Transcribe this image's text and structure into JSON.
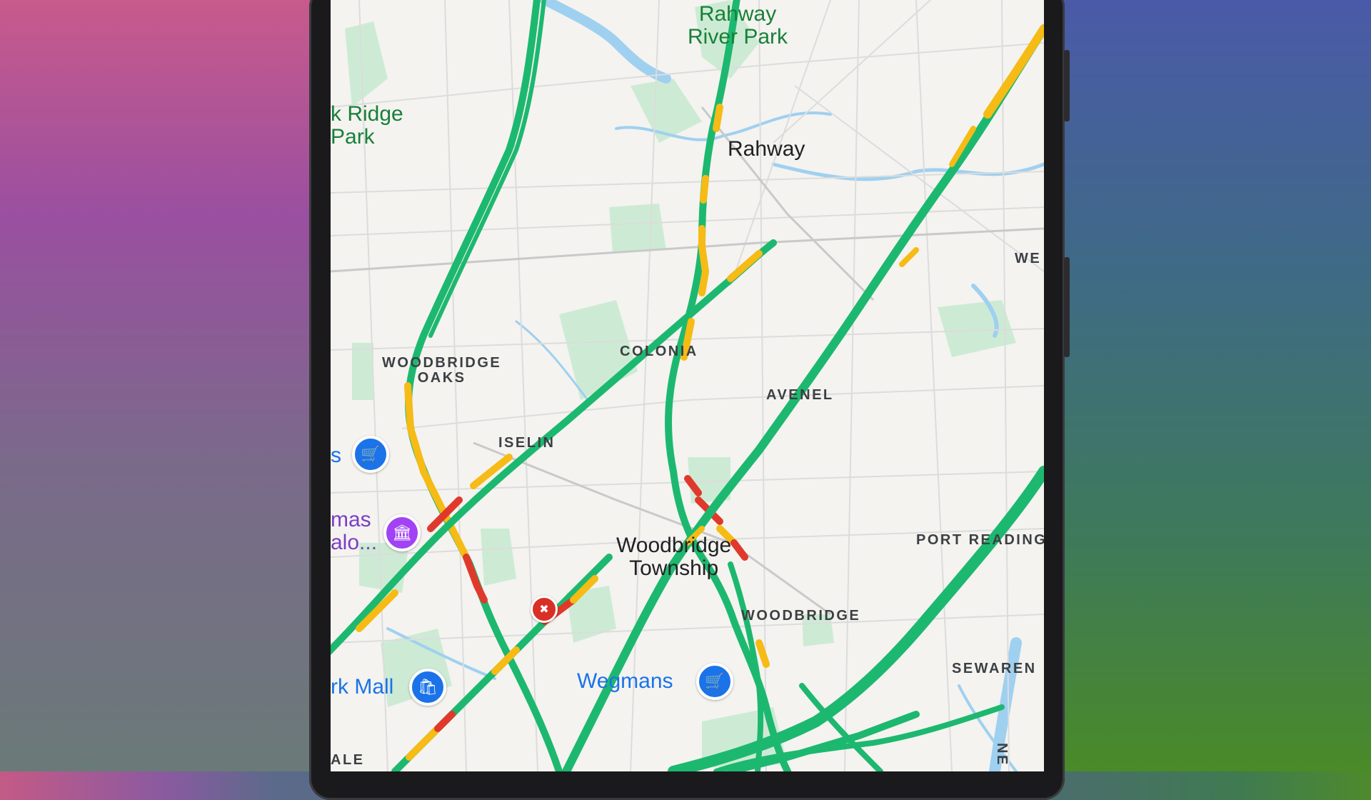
{
  "map": {
    "cities": [
      {
        "id": "rahway",
        "label": "Rahway"
      },
      {
        "id": "woodbridge-township",
        "label": "Woodbridge\nTownship"
      }
    ],
    "neighborhoods": [
      {
        "id": "woodbridge-oaks",
        "label": "WOODBRIDGE\nOAKS"
      },
      {
        "id": "colonia",
        "label": "COLONIA"
      },
      {
        "id": "avenel",
        "label": "AVENEL"
      },
      {
        "id": "iselin",
        "label": "ISELIN"
      },
      {
        "id": "port-reading",
        "label": "PORT READING"
      },
      {
        "id": "woodbridge",
        "label": "WOODBRIDGE"
      },
      {
        "id": "sewaren",
        "label": "SEWAREN"
      },
      {
        "id": "we-partial",
        "label": "WE"
      },
      {
        "id": "ale-partial",
        "label": "ALE"
      },
      {
        "id": "ne-partial",
        "label": "NE"
      }
    ],
    "parks": [
      {
        "id": "rahway-river-park",
        "label": "Rahway\nRiver Park"
      },
      {
        "id": "oak-ridge-park",
        "label": "k Ridge\nPark"
      }
    ],
    "pois": [
      {
        "id": "wegmans",
        "label": "Wegmans",
        "icon": "shopping-cart-icon"
      },
      {
        "id": "park-mall",
        "label": "rk Mall",
        "icon": "shopping-bag-icon"
      },
      {
        "id": "s-store",
        "label": "s",
        "icon": "shopping-cart-icon"
      },
      {
        "id": "mas-salon",
        "label": "mas\nalo...",
        "icon": "museum-icon"
      }
    ],
    "incident": {
      "icon": "crash-icon"
    },
    "traffic_colors": {
      "free": "#1db86f",
      "slow": "#f6bb14",
      "heavy": "#e0392b"
    },
    "colors": {
      "land": "#f4f3f0",
      "park": "#cdebd4",
      "water": "#9fd0f0",
      "road": "#ffffff"
    }
  }
}
